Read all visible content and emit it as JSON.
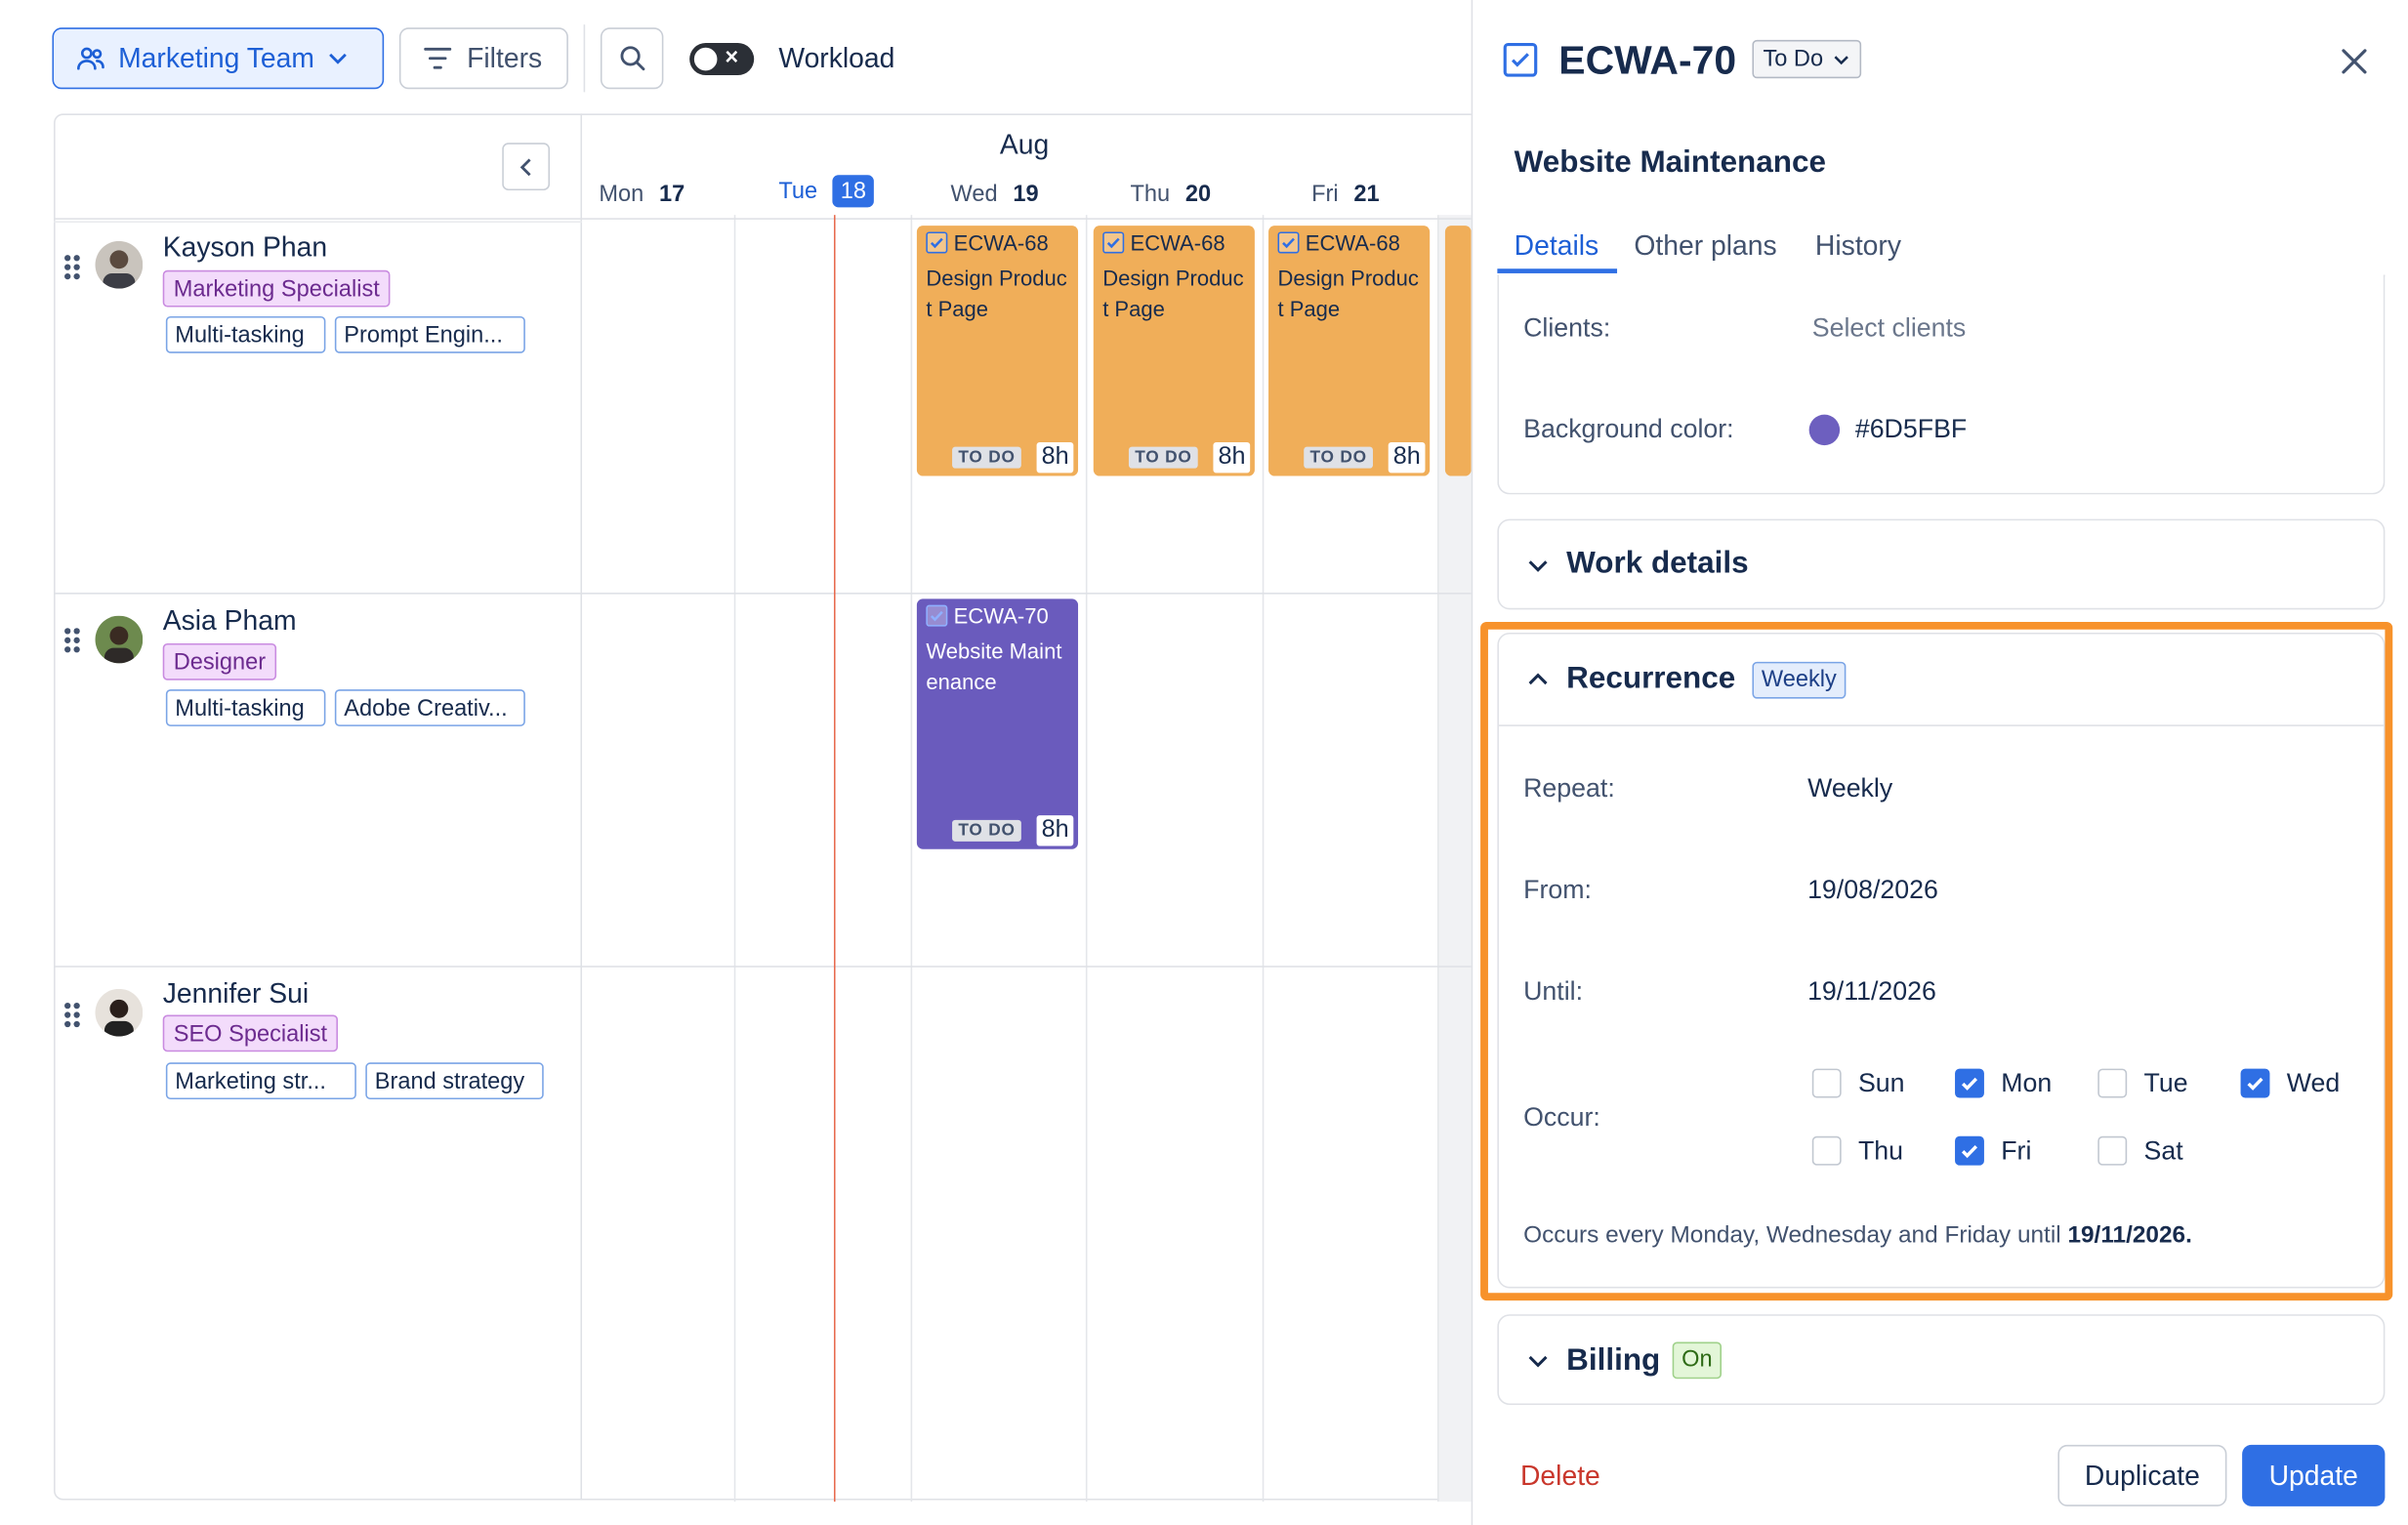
{
  "toolbar": {
    "team_label": "Marketing Team",
    "filters_label": "Filters",
    "workload_label": "Workload",
    "workload_toggle": "off"
  },
  "calendar": {
    "month": "Aug",
    "days": [
      {
        "dow": "Mon",
        "num": "17"
      },
      {
        "dow": "Tue",
        "num": "18",
        "today": true
      },
      {
        "dow": "Wed",
        "num": "19"
      },
      {
        "dow": "Thu",
        "num": "20"
      },
      {
        "dow": "Fri",
        "num": "21"
      }
    ]
  },
  "people": [
    {
      "name": "Kayson Phan",
      "role": "Marketing Specialist",
      "skills": [
        "Multi-tasking",
        "Prompt Engin..."
      ],
      "tasks": [
        {
          "id": "ECWA-68",
          "name": "Design Product Page",
          "status": "TO DO",
          "hours": "8h"
        },
        {
          "id": "ECWA-68",
          "name": "Design Product Page",
          "status": "TO DO",
          "hours": "8h"
        },
        {
          "id": "ECWA-68",
          "name": "Design Product Page",
          "status": "TO DO",
          "hours": "8h"
        }
      ]
    },
    {
      "name": "Asia Pham",
      "role": "Designer",
      "skills": [
        "Multi-tasking",
        "Adobe Creativ..."
      ],
      "tasks": [
        {
          "id": "ECWA-70",
          "name": "Website Maintenance",
          "status": "TO DO",
          "hours": "8h"
        }
      ]
    },
    {
      "name": "Jennifer Sui",
      "role": "SEO Specialist",
      "skills": [
        "Marketing str...",
        "Brand strategy"
      ],
      "tasks": []
    }
  ],
  "panel": {
    "task_id": "ECWA-70",
    "status": "To Do",
    "title": "Website Maintenance",
    "tabs": [
      "Details",
      "Other plans",
      "History"
    ],
    "clients_label": "Clients:",
    "clients_placeholder": "Select clients",
    "bg_color_label": "Background color:",
    "bg_color_value": "#6D5FBF",
    "work_details_title": "Work details",
    "recurrence": {
      "title": "Recurrence",
      "badge": "Weekly",
      "repeat_label": "Repeat:",
      "repeat_value": "Weekly",
      "from_label": "From:",
      "from_value": "19/08/2026",
      "until_label": "Until:",
      "until_value": "19/11/2026",
      "occur_label": "Occur:",
      "days": [
        {
          "label": "Sun",
          "checked": false
        },
        {
          "label": "Mon",
          "checked": true
        },
        {
          "label": "Tue",
          "checked": false
        },
        {
          "label": "Wed",
          "checked": true
        },
        {
          "label": "Thu",
          "checked": false
        },
        {
          "label": "Fri",
          "checked": true
        },
        {
          "label": "Sat",
          "checked": false
        }
      ],
      "summary_prefix": "Occurs every Monday, Wednesday and Friday until ",
      "summary_date": "19/11/2026."
    },
    "billing_title": "Billing",
    "billing_badge": "On",
    "delete_label": "Delete",
    "duplicate_label": "Duplicate",
    "update_label": "Update"
  },
  "colors": {
    "accent": "#2F6FE4",
    "task_orange": "#F0AE59",
    "task_purple": "#6D5FBF",
    "highlight": "#F7922B",
    "today_line": "#E86B4F",
    "delete": "#C9372C"
  }
}
